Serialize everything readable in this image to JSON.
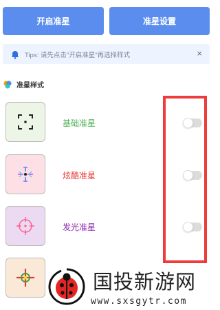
{
  "toolbar": {
    "start_label": "开启准星",
    "settings_label": "准星设置"
  },
  "tips": {
    "icon": "bell-icon",
    "text": "Tips: 请先点击\"开启准星\"再选择样式",
    "close": "×"
  },
  "section": {
    "icon": "palette-icon",
    "title": "准星样式"
  },
  "styles": [
    {
      "label": "基础准星",
      "color": "#4caf50",
      "thumb_bg": "#ecf5e6",
      "icon": "basic-crosshair-icon",
      "enabled": false
    },
    {
      "label": "炫酷准星",
      "color": "#e53935",
      "thumb_bg": "#fde0e6",
      "icon": "cool-crosshair-icon",
      "enabled": false
    },
    {
      "label": "发光准星",
      "color": "#8e24aa",
      "thumb_bg": "#ecd9f2",
      "icon": "glow-crosshair-icon",
      "enabled": false
    },
    {
      "label": "",
      "thumb_bg": "#fbe9d7",
      "icon": "red-crosshair-icon"
    }
  ],
  "watermark": {
    "title": "国投新游网",
    "url": "www.sxsgytr.com"
  }
}
